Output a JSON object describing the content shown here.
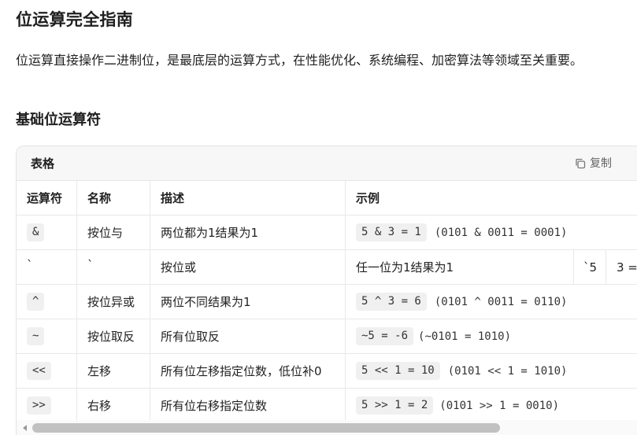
{
  "doc": {
    "title": "位运算完全指南",
    "intro": "位运算直接操作二进制位，是最底层的运算方式，在性能优化、系统编程、加密算法等领域至关重要。",
    "section_title": "基础位运算符"
  },
  "table": {
    "card_title": "表格",
    "copy_label": "复制",
    "headers": [
      "运算符",
      "名称",
      "描述",
      "示例"
    ],
    "rows": [
      {
        "op": "&",
        "name": "按位与",
        "desc": "两位都为1结果为1",
        "example_code": "5 & 3 = 1",
        "example_bin": "(0101 & 0011 = 0001)"
      },
      {
        "op": "`",
        "name": "`",
        "desc": "按位或",
        "example_text": "任一位为1结果为1",
        "extra1": "`5",
        "extra2": "3 ="
      },
      {
        "op": "^",
        "name": "按位异或",
        "desc": "两位不同结果为1",
        "example_code": "5 ^ 3 = 6",
        "example_bin": "(0101 ^ 0011 = 0110)"
      },
      {
        "op": "~",
        "name": "按位取反",
        "desc": "所有位取反",
        "example_code": "~5 = -6",
        "example_bin": "(~0101 = 1010)"
      },
      {
        "op": "<<",
        "name": "左移",
        "desc": "所有位左移指定位数，低位补0",
        "example_code": "5 << 1 = 10",
        "example_bin": "(0101 << 1 = 1010)"
      },
      {
        "op": ">>",
        "name": "右移",
        "desc": "所有位右移指定位数",
        "example_code": "5 >> 1 = 2",
        "example_bin": "(0101 >> 1 = 0010)"
      }
    ]
  },
  "icons": {
    "copy": "copy-icon",
    "scroll_left": "arrow-left-icon"
  }
}
